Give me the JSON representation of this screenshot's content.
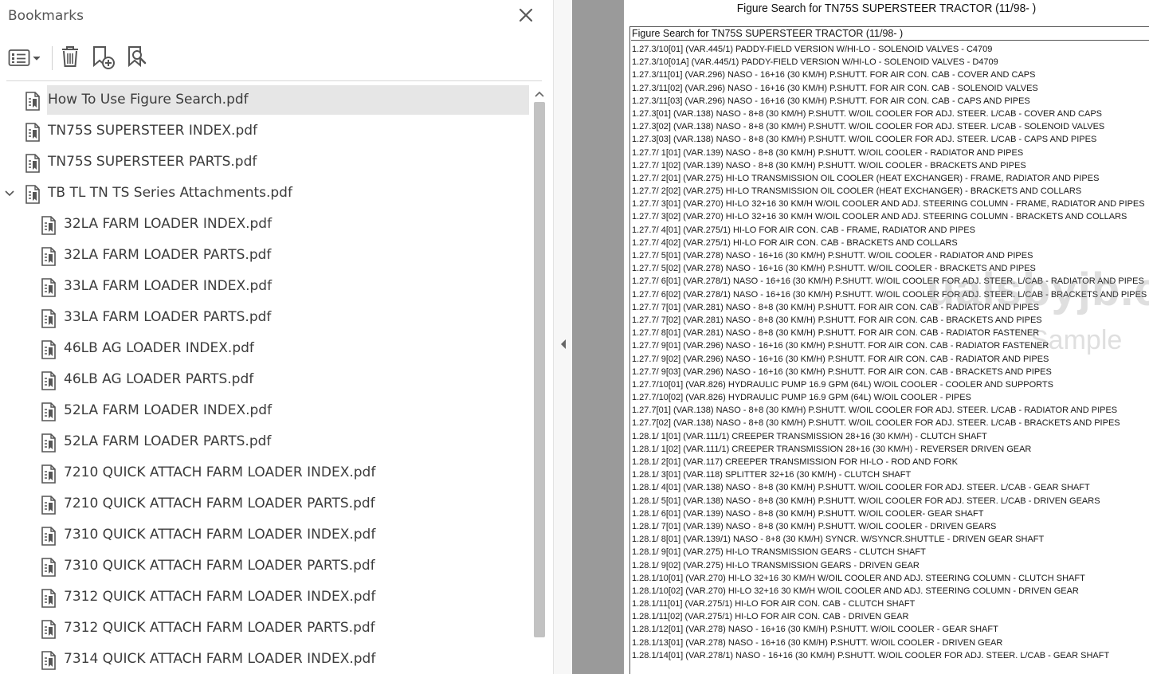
{
  "bookmarks_panel": {
    "title": "Bookmarks",
    "toolbar": {
      "options_icon": "options-list-icon",
      "delete_icon": "trash-icon",
      "new_bookmark_icon": "new-bookmark-icon",
      "find_bookmark_icon": "find-bookmark-icon"
    },
    "items": [
      {
        "label": "How To Use Figure Search.pdf",
        "level": 0,
        "selected": true
      },
      {
        "label": "TN75S SUPERSTEER INDEX.pdf",
        "level": 0
      },
      {
        "label": "TN75S SUPERSTEER PARTS.pdf",
        "level": 0
      },
      {
        "label": "TB TL TN TS Series Attachments.pdf",
        "level": 0,
        "expanded": true
      },
      {
        "label": "32LA FARM LOADER INDEX.pdf",
        "level": 1
      },
      {
        "label": "32LA FARM LOADER PARTS.pdf",
        "level": 1
      },
      {
        "label": "33LA FARM LOADER INDEX.pdf",
        "level": 1
      },
      {
        "label": "33LA FARM LOADER PARTS.pdf",
        "level": 1
      },
      {
        "label": "46LB AG LOADER INDEX.pdf",
        "level": 1
      },
      {
        "label": "46LB AG LOADER PARTS.pdf",
        "level": 1
      },
      {
        "label": "52LA FARM LOADER INDEX.pdf",
        "level": 1
      },
      {
        "label": "52LA FARM LOADER PARTS.pdf",
        "level": 1
      },
      {
        "label": "7210 QUICK ATTACH FARM LOADER INDEX.pdf",
        "level": 1
      },
      {
        "label": "7210 QUICK ATTACH FARM LOADER PARTS.pdf",
        "level": 1
      },
      {
        "label": "7310 QUICK ATTACH FARM LOADER INDEX.pdf",
        "level": 1
      },
      {
        "label": "7310 QUICK ATTACH FARM LOADER PARTS.pdf",
        "level": 1
      },
      {
        "label": "7312 QUICK ATTACH FARM LOADER INDEX.pdf",
        "level": 1
      },
      {
        "label": "7312 QUICK ATTACH FARM LOADER PARTS.pdf",
        "level": 1
      },
      {
        "label": "7314 QUICK ATTACH FARM LOADER INDEX.pdf",
        "level": 1
      }
    ]
  },
  "document": {
    "header": "Figure Search for TN75S SUPERSTEER TRACTOR (11/98- )",
    "box_title": "Figure Search for TN75S SUPERSTEER TRACTOR (11/98- )",
    "watermark_main": "ualsbyjb.com",
    "watermark_sub": "Sample",
    "lines": [
      "1.27.3/10[01] (VAR.445/1) PADDY-FIELD VERSION W/HI-LO - SOLENOID VALVES - C4709",
      "1.27.3/10[01A] (VAR.445/1) PADDY-FIELD VERSION W/HI-LO - SOLENOID VALVES - D4709",
      "1.27.3/11[01] (VAR.296) NASO - 16+16 (30 KM/H) P.SHUTT. FOR AIR CON. CAB - COVER AND CAPS",
      "1.27.3/11[02] (VAR.296) NASO - 16+16 (30 KM/H) P.SHUTT. FOR AIR CON. CAB - SOLENOID VALVES",
      "1.27.3/11[03] (VAR.296) NASO - 16+16 (30 KM/H) P.SHUTT. FOR AIR CON. CAB - CAPS AND PIPES",
      "1.27.3[01] (VAR.138) NASO - 8+8 (30 KM/H) P.SHUTT. W/OIL COOLER FOR ADJ. STEER. L/CAB - COVER AND CAPS",
      "1.27.3[02] (VAR.138) NASO - 8+8 (30 KM/H) P.SHUTT. W/OIL COOLER FOR ADJ. STEER. L/CAB - SOLENOID VALVES",
      "1.27.3[03] (VAR.138) NASO - 8+8 (30 KM/H) P.SHUTT. W/OIL COOLER FOR ADJ. STEER. L/CAB - CAPS AND PIPES",
      "1.27.7/ 1[01] (VAR.139) NASO - 8+8 (30 KM/H) P.SHUTT. W/OIL COOLER - RADIATOR AND PIPES",
      "1.27.7/ 1[02] (VAR.139) NASO - 8+8 (30 KM/H) P.SHUTT. W/OIL COOLER - BRACKETS AND PIPES",
      "1.27.7/ 2[01] (VAR.275) HI-LO TRANSMISSION OIL COOLER (HEAT EXCHANGER) - FRAME, RADIATOR AND PIPES",
      "1.27.7/ 2[02] (VAR.275) HI-LO TRANSMISSION OIL COOLER (HEAT EXCHANGER) - BRACKETS AND COLLARS",
      "1.27.7/ 3[01] (VAR.270) HI-LO 32+16 30 KM/H W/OIL COOLER AND ADJ. STEERING COLUMN - FRAME, RADIATOR AND PIPES",
      "1.27.7/ 3[02] (VAR.270) HI-LO 32+16 30 KM/H W/OIL COOLER AND ADJ. STEERING COLUMN - BRACKETS AND COLLARS",
      "1.27.7/ 4[01] (VAR.275/1) HI-LO FOR AIR CON. CAB - FRAME, RADIATOR AND PIPES",
      "1.27.7/ 4[02] (VAR.275/1) HI-LO FOR AIR CON. CAB - BRACKETS AND COLLARS",
      "1.27.7/ 5[01] (VAR.278) NASO - 16+16 (30 KM/H) P.SHUTT. W/OIL COOLER - RADIATOR AND PIPES",
      "1.27.7/ 5[02] (VAR.278) NASO - 16+16 (30 KM/H) P.SHUTT. W/OIL COOLER - BRACKETS AND PIPES",
      "1.27.7/ 6[01] (VAR.278/1) NASO - 16+16 (30 KM/H) P.SHUTT. W/OIL COOLER FOR ADJ. STEER. L/CAB - RADIATOR AND PIPES",
      "1.27.7/ 6[02] (VAR.278/1) NASO - 16+16 (30 KM/H) P.SHUTT. W/OIL COOLER FOR ADJ. STEER. L/CAB - BRACKETS AND PIPES",
      "1.27.7/ 7[01] (VAR.281) NASO - 8+8 (30 KM/H) P.SHUTT. FOR AIR CON. CAB - RADIATOR AND PIPES",
      "1.27.7/ 7[02] (VAR.281) NASO - 8+8 (30 KM/H) P.SHUTT. FOR AIR CON. CAB - BRACKETS AND PIPES",
      "1.27.7/ 8[01] (VAR.281) NASO - 8+8 (30 KM/H) P.SHUTT. FOR AIR CON. CAB - RADIATOR FASTENER",
      "1.27.7/ 9[01] (VAR.296) NASO - 16+16 (30 KM/H) P.SHUTT. FOR AIR CON. CAB - RADIATOR FASTENER",
      "1.27.7/ 9[02] (VAR.296) NASO - 16+16 (30 KM/H) P.SHUTT. FOR AIR CON. CAB - RADIATOR AND PIPES",
      "1.27.7/ 9[03] (VAR.296) NASO - 16+16 (30 KM/H) P.SHUTT. FOR AIR CON. CAB - BRACKETS AND PIPES",
      "1.27.7/10[01] (VAR.826) HYDRAULIC PUMP 16.9 GPM (64L) W/OIL COOLER - COOLER AND SUPPORTS",
      "1.27.7/10[02] (VAR.826) HYDRAULIC PUMP 16.9 GPM (64L) W/OIL COOLER - PIPES",
      "1.27.7[01] (VAR.138) NASO - 8+8 (30 KM/H) P.SHUTT. W/OIL COOLER FOR ADJ. STEER. L/CAB - RADIATOR AND PIPES",
      "1.27.7[02] (VAR.138) NASO - 8+8 (30 KM/H) P.SHUTT. W/OIL COOLER FOR ADJ. STEER. L/CAB - BRACKETS AND PIPES",
      "1.28.1/ 1[01] (VAR.111/1) CREEPER TRANSMISSION 28+16 (30 KM/H) - CLUTCH SHAFT",
      "1.28.1/ 1[02] (VAR.111/1) CREEPER TRANSMISSION 28+16 (30 KM/H) - REVERSER DRIVEN GEAR",
      "1.28.1/ 2[01] (VAR.117) CREEPER TRANSMISSION FOR HI-LO - ROD AND FORK",
      "1.28.1/ 3[01] (VAR.118) SPLITTER 32+16 (30 KM/H) - CLUTCH SHAFT",
      "1.28.1/ 4[01] (VAR.138) NASO - 8+8 (30 KM/H) P.SHUTT. W/OIL COOLER FOR ADJ. STEER. L/CAB - GEAR SHAFT",
      "1.28.1/ 5[01] (VAR.138) NASO - 8+8 (30 KM/H) P.SHUTT. W/OIL COOLER FOR ADJ. STEER. L/CAB - DRIVEN GEARS",
      "1.28.1/ 6[01] (VAR.139) NASO - 8+8 (30 KM/H) P.SHUTT. W/OIL COOLER- GEAR SHAFT",
      "1.28.1/ 7[01] (VAR.139) NASO - 8+8 (30 KM/H) P.SHUTT. W/OIL COOLER - DRIVEN GEARS",
      "1.28.1/ 8[01] (VAR.139/1) NASO - 8+8 (30 KM/H) SYNCR. W/SYNCR.SHUTTLE - DRIVEN GEAR SHAFT",
      "1.28.1/ 9[01] (VAR.275) HI-LO TRANSMISSION GEARS - CLUTCH SHAFT",
      "1.28.1/ 9[02] (VAR.275) HI-LO TRANSMISSION GEARS - DRIVEN GEAR",
      "1.28.1/10[01] (VAR.270) HI-LO 32+16 30 KM/H W/OIL COOLER AND ADJ. STEERING COLUMN - CLUTCH SHAFT",
      "1.28.1/10[02] (VAR.270) HI-LO 32+16 30 KM/H W/OIL COOLER AND ADJ. STEERING COLUMN - DRIVEN GEAR",
      "1.28.1/11[01] (VAR.275/1) HI-LO FOR AIR CON. CAB - CLUTCH SHAFT",
      "1.28.1/11[02] (VAR.275/1) HI-LO FOR AIR CON. CAB - DRIVEN GEAR",
      "1.28.1/12[01] (VAR.278) NASO - 16+16 (30 KM/H) P.SHUTT. W/OIL COOLER - GEAR SHAFT",
      "1.28.1/13[01] (VAR.278) NASO - 16+16 (30 KM/H) P.SHUTT. W/OIL COOLER - DRIVEN GEAR",
      "1.28.1/14[01] (VAR.278/1) NASO - 16+16 (30 KM/H) P.SHUTT. W/OIL COOLER FOR ADJ. STEER. L/CAB - GEAR SHAFT"
    ]
  }
}
